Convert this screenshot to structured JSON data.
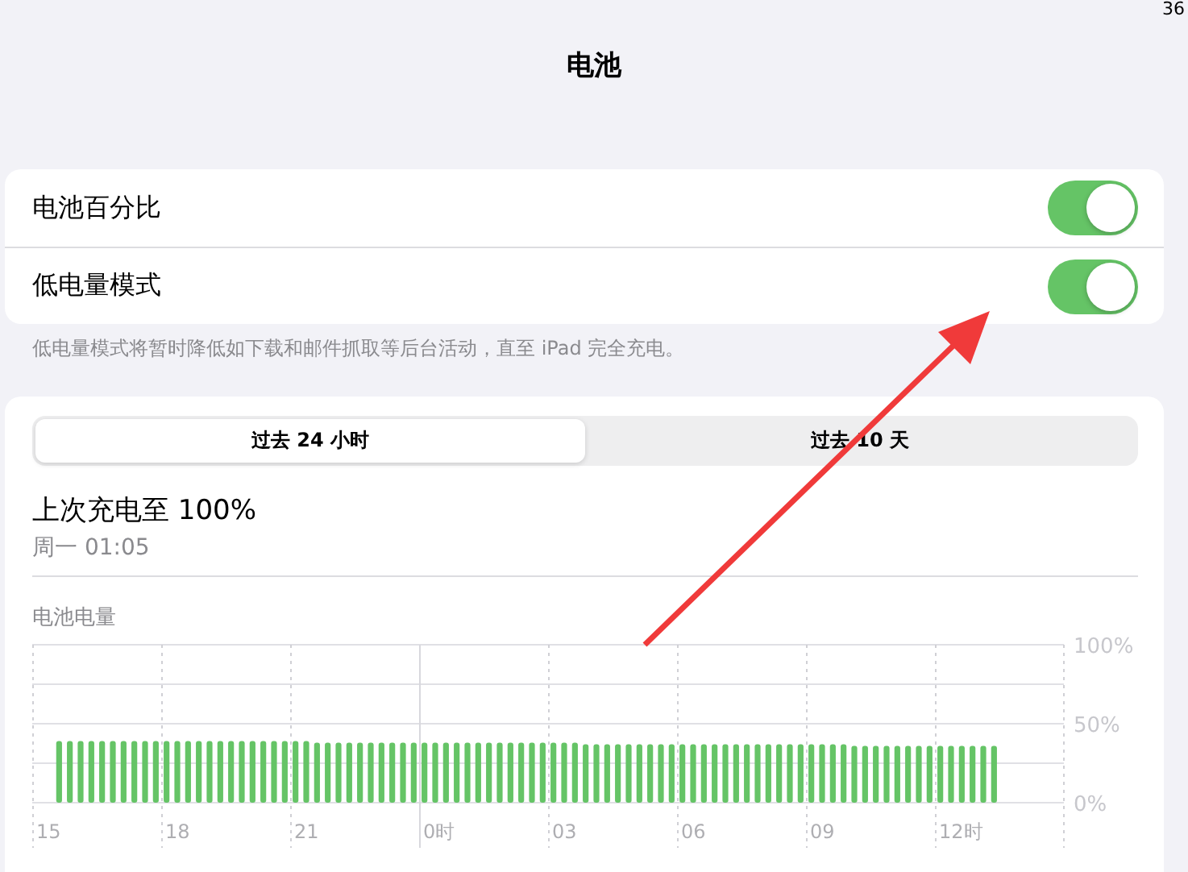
{
  "status_bar": {
    "battery": "36"
  },
  "title": "电池",
  "settings": [
    {
      "label": "电池百分比",
      "on": true
    },
    {
      "label": "低电量模式",
      "on": true
    }
  ],
  "footnote": "低电量模式将暂时降低如下载和邮件抓取等后台活动，直至 iPad 完全充电。",
  "segments": [
    {
      "label": "过去 24 小时",
      "selected": true
    },
    {
      "label": "过去 10 天",
      "selected": false
    }
  ],
  "last_charge": {
    "title": "上次充电至 100%",
    "time": "周一 01:05"
  },
  "battery_level": {
    "title": "电池电量",
    "chart_data": {
      "type": "bar",
      "ylim": [
        0,
        100
      ],
      "yticks": [
        {
          "value": 0,
          "label": "0%"
        },
        {
          "value": 50,
          "label": "50%"
        },
        {
          "value": 100,
          "label": "100%"
        }
      ],
      "categories": [
        null,
        "15",
        null,
        null,
        null,
        null,
        null,
        null,
        null,
        null,
        null,
        null,
        null,
        "18",
        null,
        null,
        null,
        null,
        null,
        null,
        null,
        null,
        null,
        null,
        null,
        "21",
        null,
        null,
        null,
        null,
        null,
        null,
        null,
        null,
        null,
        null,
        null,
        "0时",
        null,
        null,
        null,
        null,
        null,
        null,
        null,
        null,
        null,
        null,
        null,
        "03",
        null,
        null,
        null,
        null,
        null,
        null,
        null,
        null,
        null,
        null,
        null,
        "06",
        null,
        null,
        null,
        null,
        null,
        null,
        null,
        null,
        null,
        null,
        null,
        "09",
        null,
        null,
        null,
        null,
        null,
        null,
        null,
        null,
        null,
        null,
        null,
        "12时",
        null,
        null,
        null,
        null,
        null,
        null,
        null,
        null,
        null,
        null
      ],
      "series": [
        {
          "color": "#65c466",
          "values": [
            null,
            null,
            39,
            39,
            39,
            39,
            39,
            39,
            39,
            39,
            39,
            39,
            39,
            39,
            39,
            39,
            39,
            39,
            39,
            39,
            39,
            39,
            39,
            39,
            39,
            39,
            38,
            38,
            38,
            38,
            38,
            38,
            38,
            38,
            38,
            38,
            38,
            38,
            38,
            38,
            38,
            38,
            38,
            38,
            38,
            38,
            38,
            38,
            38,
            38,
            38,
            37,
            37,
            37,
            37,
            37,
            37,
            37,
            37,
            37,
            37,
            37,
            37,
            37,
            37,
            37,
            37,
            37,
            37,
            37,
            37,
            37,
            37,
            37,
            37,
            37,
            36,
            36,
            36,
            36,
            36,
            36,
            36,
            36,
            36,
            36,
            36,
            36,
            36,
            36,
            null,
            null,
            null,
            null,
            null,
            null
          ]
        }
      ]
    }
  }
}
